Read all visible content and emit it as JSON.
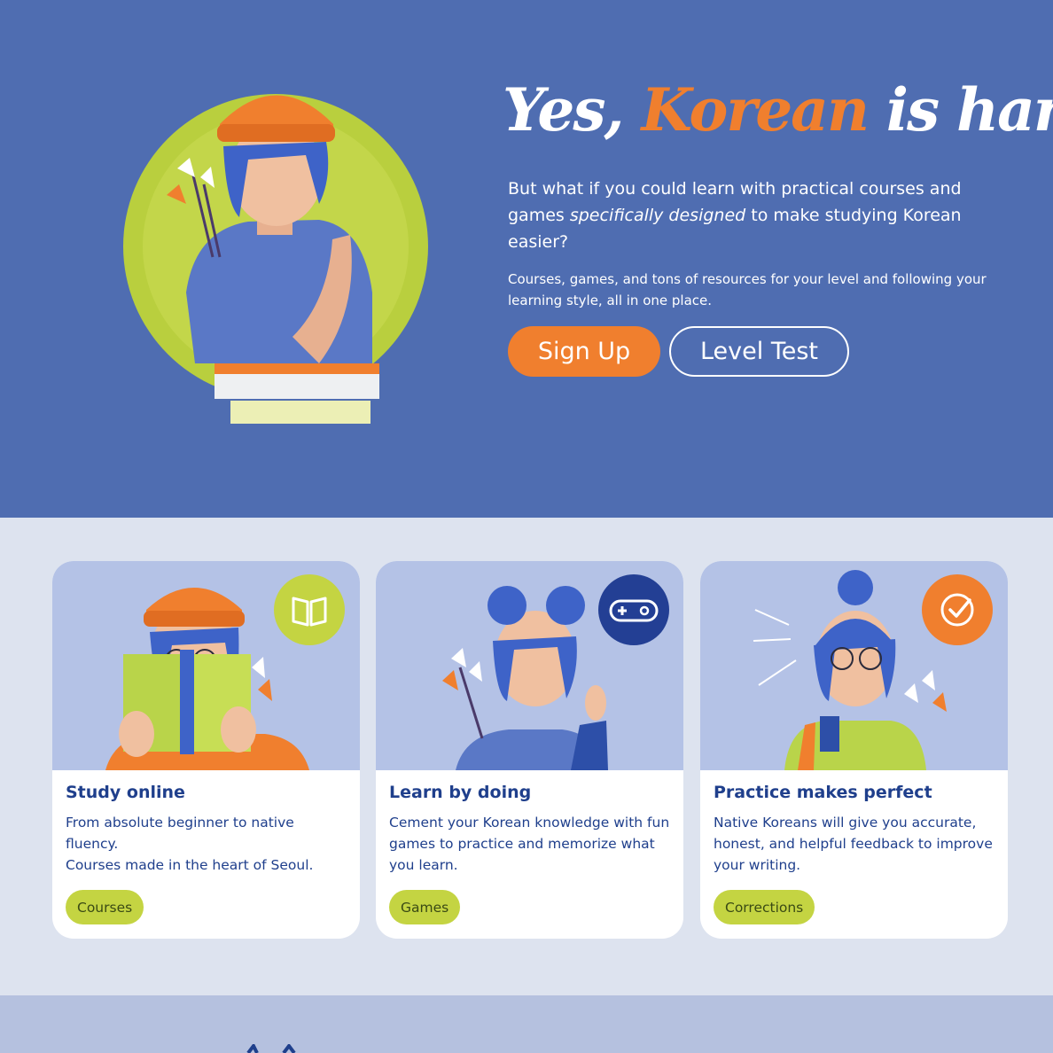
{
  "hero": {
    "title_part1": "Yes, ",
    "title_accent": "Korean",
    "title_part2": " is hard",
    "lead_part1": "But what if you could learn with practical courses and games ",
    "lead_em": "specifically designed",
    "lead_part2": " to make studying Korean easier?",
    "sub": "Courses, games, and tons of resources for your level and following your learning style, all in one place.",
    "signup_label": "Sign Up",
    "level_test_label": "Level Test"
  },
  "cards": [
    {
      "title": "Study online",
      "desc_lines": [
        "From absolute beginner to native fluency.",
        "Courses made in the heart of Seoul."
      ],
      "tag": "Courses",
      "icon": "book-icon"
    },
    {
      "title": "Learn by doing",
      "desc_lines": [
        "Cement your Korean knowledge with fun games to practice and memorize what you learn."
      ],
      "tag": "Games",
      "icon": "gamepad-icon"
    },
    {
      "title": "Practice makes perfect",
      "desc_lines": [
        "Native Koreans will give you accurate, honest, and helpful feedback to improve your writing."
      ],
      "tag": "Corrections",
      "icon": "check-circle-icon"
    }
  ],
  "colors": {
    "hero_bg": "#4f6db1",
    "accent_orange": "#f07f2e",
    "lime": "#c4d442",
    "navy": "#1f3f8c",
    "section_bg": "#dde3ef",
    "card_art_bg": "#b4c2e6"
  }
}
